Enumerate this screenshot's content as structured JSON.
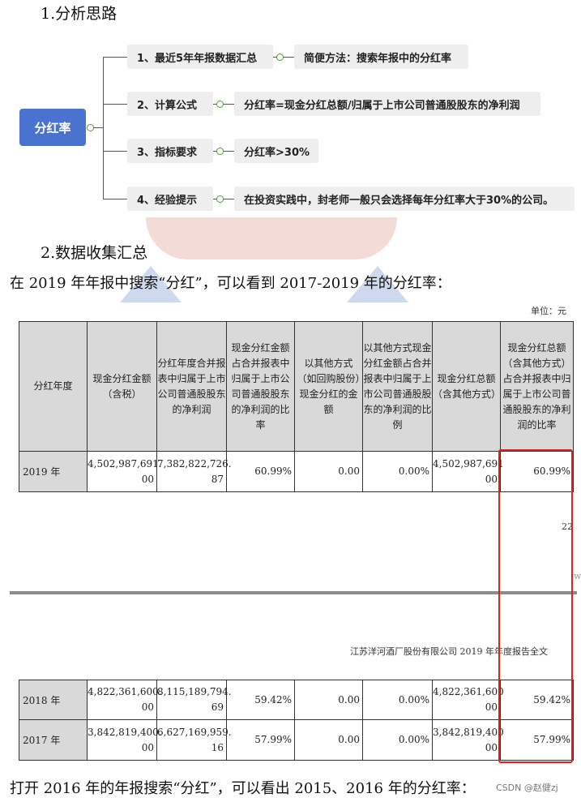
{
  "section1_title": "1.分析思路",
  "mindmap": {
    "root": "分红率",
    "branches": [
      {
        "label": "1、最近5年年报数据汇总",
        "detail": "简便方法：搜索年报中的分红率"
      },
      {
        "label": "2、计算公式",
        "detail": "分红率=现金分红总额/归属于上市公司普通股股东的净利润"
      },
      {
        "label": "3、指标要求",
        "detail": "分红率>30%"
      },
      {
        "label": "4、经验提示",
        "detail": "在投资实践中，封老师一般只会选择每年分红率大于30%的公司。"
      }
    ]
  },
  "section2_title": "2.数据收集汇总",
  "intro_text": "在 2019 年年报中搜索“分红”，可以看到 2017-2019 年的分红率：",
  "unit_label": "单位：元",
  "table_headers": [
    "分红年度",
    "现金分红金额（含税）",
    "分红年度合并报表中归属于上市公司普通股股东的净利润",
    "现金分红金额占合并报表中归属于上市公司普通股股东的净利润的比率",
    "以其他方式（如回购股份）现金分红的金额",
    "以其他方式现金分红金额占合并报表中归属于上市公司普通股股东的净利润的比例",
    "现金分红总额（含其他方式）",
    "现金分红总额（含其他方式）占合并报表中归属于上市公司普通股股东的净利润的比率"
  ],
  "rows_top": [
    {
      "year": "2019 年",
      "cash_a": "4,502,987,691.",
      "cash_b": "00",
      "profit_a": "7,382,822,726.",
      "profit_b": "87",
      "ratio": "60.99%",
      "other": "0.00",
      "other_ratio": "0.00%",
      "total_a": "4,502,987,691",
      "total_b": "00",
      "total_ratio": "60.99%"
    }
  ],
  "page_num_fragment": "22",
  "side_fragment": "w",
  "company_line": "江苏洋河酒厂股份有限公司 2019 年年度报告全文",
  "rows_bottom": [
    {
      "year": "2018 年",
      "cash_a": "4,822,361,600.",
      "cash_b": "00",
      "profit_a": "8,115,189,794.",
      "profit_b": "69",
      "ratio": "59.42%",
      "other": "0.00",
      "other_ratio": "0.00%",
      "total_a": "4,822,361,600",
      "total_b": "00",
      "total_ratio": "59.42%"
    },
    {
      "year": "2017 年",
      "cash_a": "3,842,819,400.",
      "cash_b": "00",
      "profit_a": "6,627,169,959.",
      "profit_b": "16",
      "ratio": "57.99%",
      "other": "0.00",
      "other_ratio": "0.00%",
      "total_a": "3,842,819,400",
      "total_b": "00",
      "total_ratio": "57.99%"
    }
  ],
  "outro_text": "打开 2016 年的年报搜索“分红”，可以看出 2015、2016 年的分红率：",
  "watermark": "CSDN @赵健zj",
  "colors": {
    "root": "#4a72cf",
    "node": "#eeeeee",
    "highlight": "#e0221f",
    "header": "#d9d9d9"
  }
}
